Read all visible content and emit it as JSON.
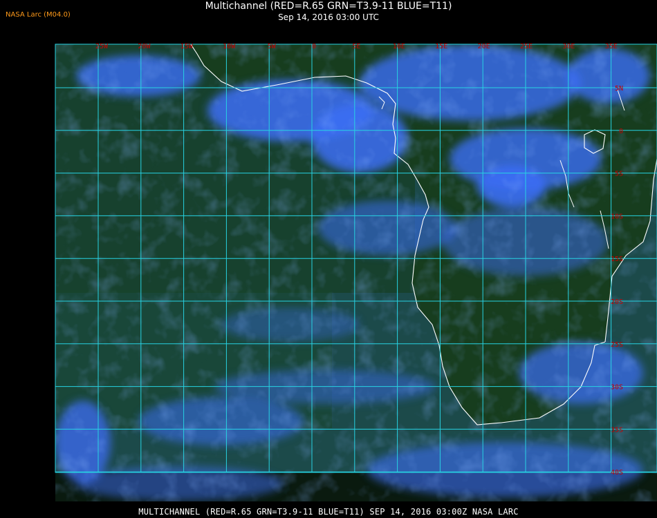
{
  "header": {
    "tag": "NASA Larc (M04.0)",
    "title": "Multichannel (RED=R.65 GRN=T3.9-11 BLUE=T11)",
    "subtitle": "Sep 14, 2016 03:00 UTC"
  },
  "footer": {
    "text": "MULTICHANNEL (RED=R.65 GRN=T3.9-11 BLUE=T11) SEP 14, 2016 03:00Z   NASA LARC"
  },
  "map": {
    "lon_labels": [
      "25W",
      "20W",
      "15W",
      "10W",
      "5W",
      "0",
      "5E",
      "10E",
      "15E",
      "20E",
      "25E",
      "30E",
      "35E"
    ],
    "lat_labels": [
      "5N",
      "0",
      "5S",
      "10S",
      "15S",
      "20S",
      "25S",
      "30S",
      "35S",
      "40S"
    ],
    "colors": {
      "grid": "#27d3e3",
      "label": "#c80000",
      "coast": "#ffffff",
      "ocean": "#1b4a52",
      "land": "#173f1c",
      "cloud": "#3a6cf0"
    }
  }
}
